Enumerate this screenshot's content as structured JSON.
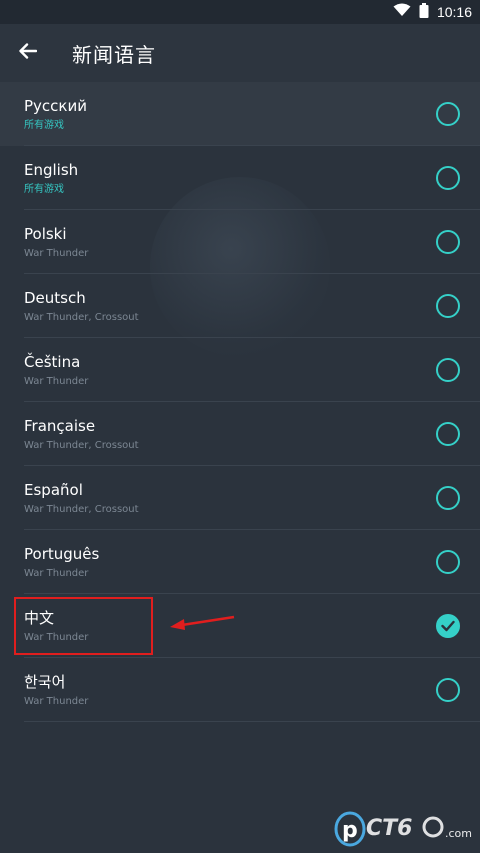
{
  "status_bar": {
    "time": "10:16"
  },
  "header": {
    "title": "新闻语言"
  },
  "languages": [
    {
      "name": "Русский",
      "subtitle": "所有游戏",
      "subtitle_accent": true,
      "selected": false
    },
    {
      "name": "English",
      "subtitle": "所有游戏",
      "subtitle_accent": true,
      "selected": false
    },
    {
      "name": "Polski",
      "subtitle": "War Thunder",
      "subtitle_accent": false,
      "selected": false
    },
    {
      "name": "Deutsch",
      "subtitle": "War Thunder, Crossout",
      "subtitle_accent": false,
      "selected": false
    },
    {
      "name": "Čeština",
      "subtitle": "War Thunder",
      "subtitle_accent": false,
      "selected": false
    },
    {
      "name": "Française",
      "subtitle": "War Thunder, Crossout",
      "subtitle_accent": false,
      "selected": false
    },
    {
      "name": "Español",
      "subtitle": "War Thunder, Crossout",
      "subtitle_accent": false,
      "selected": false
    },
    {
      "name": "Português",
      "subtitle": "War Thunder",
      "subtitle_accent": false,
      "selected": false
    },
    {
      "name": "中文",
      "subtitle": "War Thunder",
      "subtitle_accent": false,
      "selected": true
    },
    {
      "name": "한국어",
      "subtitle": "War Thunder",
      "subtitle_accent": false,
      "selected": false
    }
  ],
  "watermark": {
    "text": ".com"
  },
  "colors": {
    "background": "#2b333d",
    "accent": "#35d0c8",
    "annotation": "#e01e1e"
  }
}
